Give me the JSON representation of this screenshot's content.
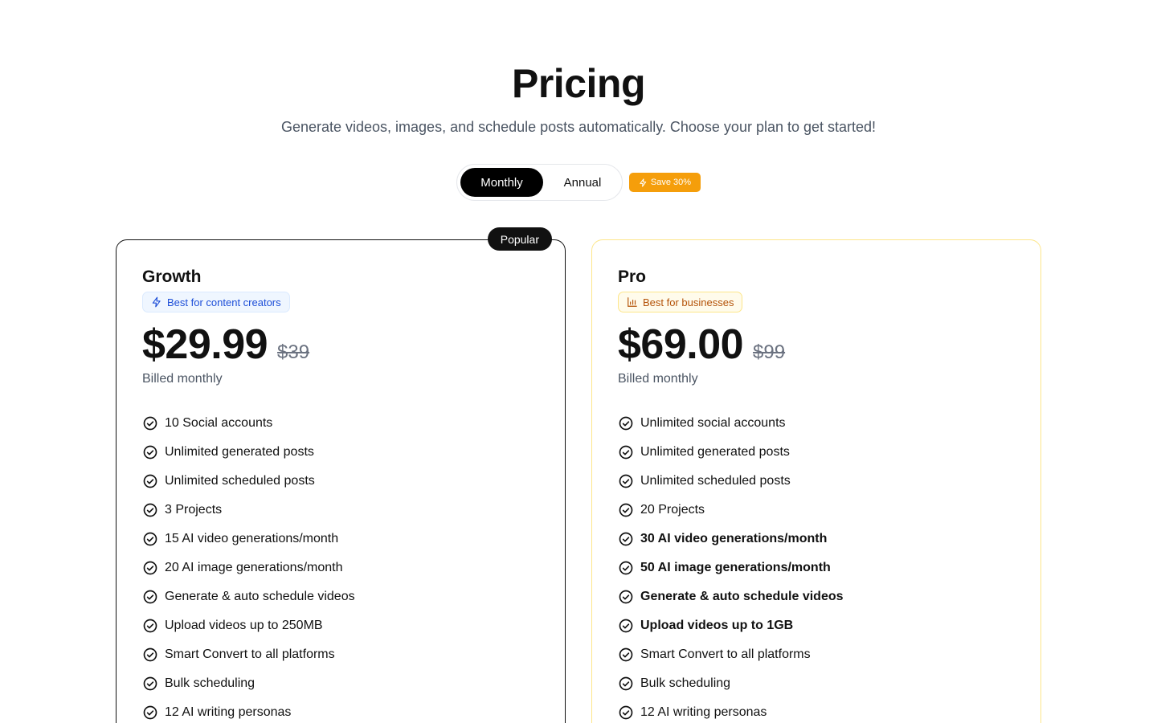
{
  "header": {
    "title": "Pricing",
    "subtitle": "Generate videos, images, and schedule posts automatically. Choose your plan to get started!"
  },
  "billing_toggle": {
    "options": [
      "Monthly",
      "Annual"
    ],
    "selected": "Monthly",
    "save_badge": "Save 30%",
    "save_icon": "lightning-icon"
  },
  "colors": {
    "accent": "#f59e0b",
    "primary": "#000000",
    "growth_tag": "#1d4ed8",
    "pro_tag": "#b45309"
  },
  "plans": [
    {
      "name": "Growth",
      "badge": "Popular",
      "tag": "Best for content creators",
      "tag_icon": "lightning-icon",
      "price": "$29.99",
      "old_price": "$39",
      "billing": "Billed monthly",
      "features": [
        "10 Social accounts",
        "Unlimited generated posts",
        "Unlimited scheduled posts",
        "3 Projects",
        "15 AI video generations/month",
        "20 AI image generations/month",
        "Generate & auto schedule videos",
        "Upload videos up to 250MB",
        "Smart Convert to all platforms",
        "Bulk scheduling",
        "12 AI writing personas"
      ]
    },
    {
      "name": "Pro",
      "tag": "Best for businesses",
      "tag_icon": "bar-chart-icon",
      "price": "$69.00",
      "old_price": "$99",
      "billing": "Billed monthly",
      "features": [
        "Unlimited social accounts",
        "Unlimited generated posts",
        "Unlimited scheduled posts",
        "20 Projects",
        "30 AI video generations/month",
        "50 AI image generations/month",
        "Generate & auto schedule videos",
        "Upload videos up to 1GB",
        "Smart Convert to all platforms",
        "Bulk scheduling",
        "12 AI writing personas"
      ],
      "bold_features": [
        4,
        5,
        6,
        7
      ]
    }
  ]
}
